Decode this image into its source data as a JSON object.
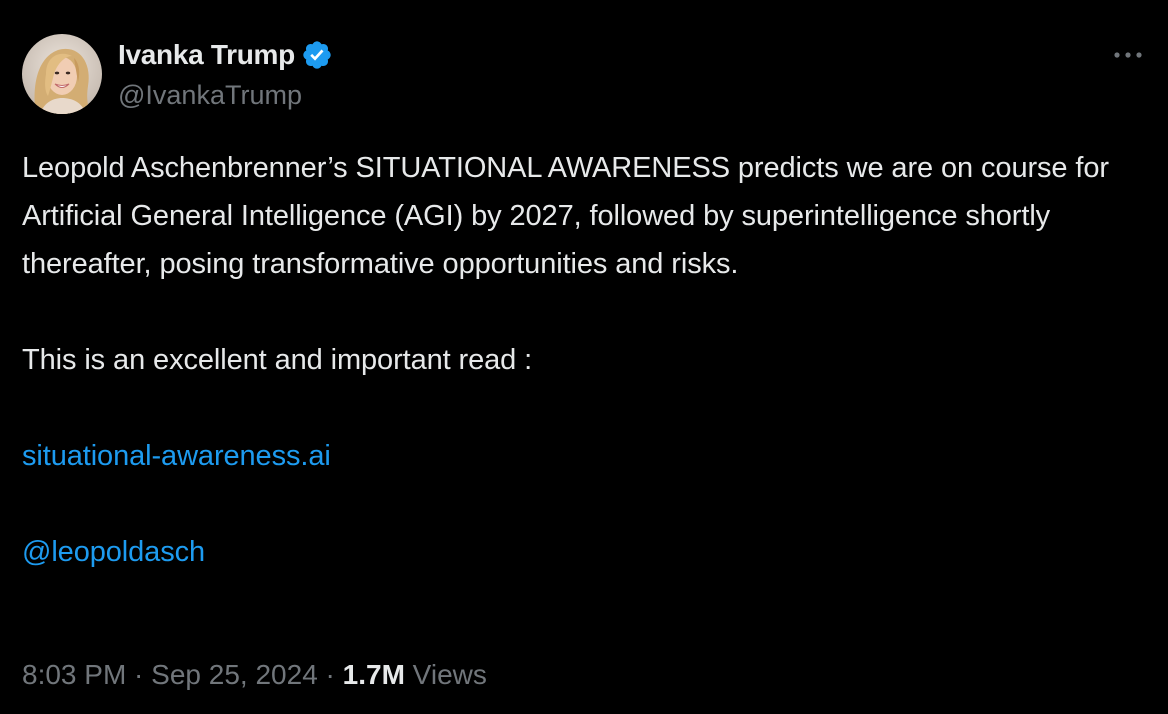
{
  "author": {
    "display_name": "Ivanka Trump",
    "handle": "@IvankaTrump",
    "verified": true,
    "verified_icon": "verified-badge-icon",
    "avatar_icon": "profile-photo"
  },
  "more_icon": "more-horizontal-icon",
  "tweet": {
    "paragraph_1": "Leopold Aschenbrenner’s SITUATIONAL AWARENESS predicts we are on course for Artificial General Intelligence (AGI) by 2027, followed by superintelligence shortly thereafter, posing transformative opportunities and risks.",
    "paragraph_2": "This is an excellent and important read :",
    "link": "situational-awareness.ai",
    "mention": "@leopoldasch"
  },
  "meta": {
    "time": "8:03 PM",
    "separator_1": " · ",
    "date": "Sep 25, 2024",
    "separator_2": " · ",
    "views_count": "1.7M",
    "views_label": " Views"
  },
  "colors": {
    "background": "#000000",
    "text": "#e7e9ea",
    "secondary": "#71767b",
    "link": "#1d9bf0"
  }
}
